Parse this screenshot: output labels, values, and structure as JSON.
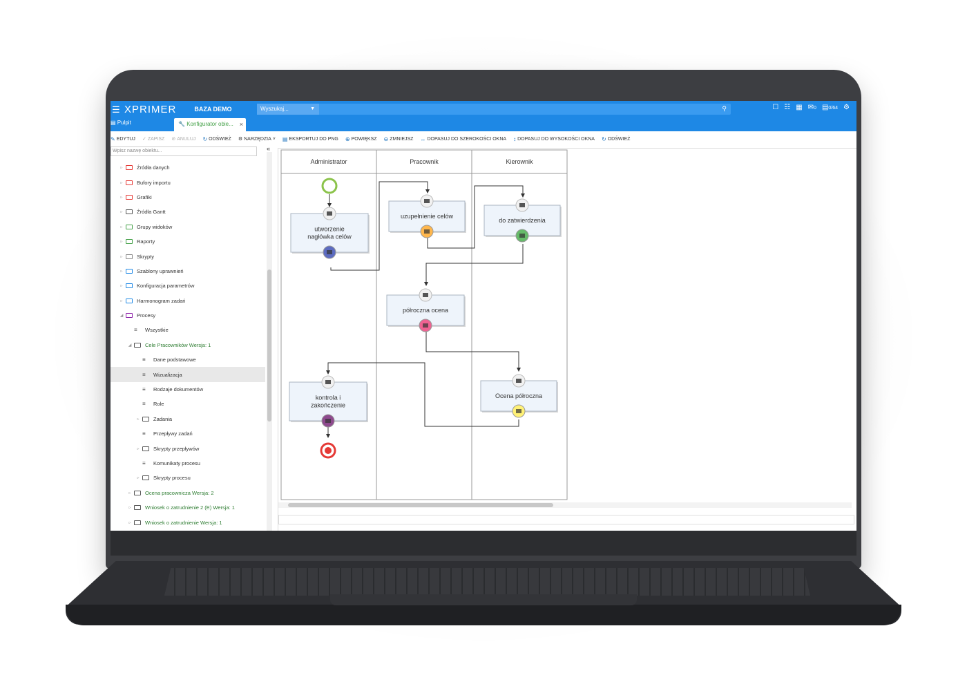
{
  "header": {
    "menu_icon": "hamburger-icon",
    "logo": "XPRIMER",
    "database": "BAZA DEMO",
    "search_select": "Wyszukaj...",
    "notifications_count": "0",
    "messages_count": "0/64"
  },
  "tabs": {
    "home": "Pulpit",
    "active": "Konfigurator obie...",
    "accent_color": "#43a047"
  },
  "toolbar": {
    "edit": "EDYTUJ",
    "save": "ZAPISZ",
    "cancel": "ANULUJ",
    "refresh": "ODŚWIEŻ",
    "tools": "NARZĘDZIA",
    "export_png": "EKSPORTUJ DO PNG",
    "zoom_in": "POWIĘKSZ",
    "zoom_out": "ZMNIEJSZ",
    "fit_width": "DOPASUJ DO SZEROKOŚCI OKNA",
    "fit_height": "DOPASUJ DO WYSOKOŚCI OKNA",
    "refresh2": "ODŚWIEŻ"
  },
  "sidebar": {
    "filter_placeholder": "Wpisz nazwę obiektu...",
    "items": [
      {
        "label": "Źródła danych",
        "level": 1,
        "icon": "folder-icon",
        "icon_color": "#e53935"
      },
      {
        "label": "Bufory importu",
        "level": 1,
        "icon": "folder-icon",
        "icon_color": "#e53935"
      },
      {
        "label": "Grafiki",
        "level": 1,
        "icon": "folder-icon",
        "icon_color": "#e53935"
      },
      {
        "label": "Źródła Gantt",
        "level": 1,
        "icon": "folder-icon",
        "icon_color": "#555555"
      },
      {
        "label": "Grupy widoków",
        "level": 1,
        "icon": "folder-icon",
        "icon_color": "#43a047"
      },
      {
        "label": "Raporty",
        "level": 1,
        "icon": "folder-icon",
        "icon_color": "#43a047"
      },
      {
        "label": "Skrypty",
        "level": 1,
        "icon": "folder-icon",
        "icon_color": "#888888"
      },
      {
        "label": "Szablony uprawnień",
        "level": 1,
        "icon": "folder-icon",
        "icon_color": "#1e88e5"
      },
      {
        "label": "Konfiguracja parametrów",
        "level": 1,
        "icon": "folder-icon",
        "icon_color": "#1e88e5"
      },
      {
        "label": "Harmonogram zadań",
        "level": 1,
        "icon": "folder-icon",
        "icon_color": "#1e88e5"
      },
      {
        "label": "Procesy",
        "level": 1,
        "icon": "folder-icon",
        "icon_color": "#8e24aa",
        "expanded": true
      },
      {
        "label": "Wszystkie",
        "level": 2,
        "icon": "list-icon"
      },
      {
        "label": "Cele Pracowników Wersja: 1",
        "level": 2,
        "icon": "folder-icon",
        "icon_color": "#555555",
        "expanded": true,
        "green": true
      },
      {
        "label": "Dane podstawowe",
        "level": 3,
        "icon": "list-icon"
      },
      {
        "label": "Wizualizacja",
        "level": 3,
        "icon": "list-icon",
        "selected": true
      },
      {
        "label": "Rodzaje dokumentów",
        "level": 3,
        "icon": "list-icon"
      },
      {
        "label": "Role",
        "level": 3,
        "icon": "list-icon"
      },
      {
        "label": "Zadania",
        "level": 3,
        "icon": "folder-icon",
        "icon_color": "#555555"
      },
      {
        "label": "Przepływy zadań",
        "level": 3,
        "icon": "list-icon"
      },
      {
        "label": "Skrypty przepływów",
        "level": 3,
        "icon": "folder-icon",
        "icon_color": "#555555"
      },
      {
        "label": "Komunikaty procesu",
        "level": 3,
        "icon": "list-icon"
      },
      {
        "label": "Skrypty procesu",
        "level": 3,
        "icon": "folder-icon",
        "icon_color": "#555555"
      },
      {
        "label": "Ocena pracownicza Wersja: 2",
        "level": 2,
        "icon": "folder-icon",
        "icon_color": "#555555",
        "green": true
      },
      {
        "label": "Wniosek o zatrudnienie 2 (E) Wersja: 1",
        "level": 2,
        "icon": "folder-icon",
        "icon_color": "#555555",
        "green": true
      },
      {
        "label": "Wniosek o zatrudnienie Wersja: 1",
        "level": 2,
        "icon": "folder-icon",
        "icon_color": "#555555",
        "green": true
      }
    ]
  },
  "diagram": {
    "lanes": [
      "Administrator",
      "Pracownik",
      "Kierownik"
    ],
    "tasks": [
      {
        "id": "t1",
        "lines": [
          "utworzenie",
          "nagłówka celów"
        ],
        "badge_color": "#5c6bc0"
      },
      {
        "id": "t2",
        "lines": [
          "uzupełnienie celów"
        ],
        "badge_color": "#ffb74d"
      },
      {
        "id": "t3",
        "lines": [
          "do zatwierdzenia"
        ],
        "badge_color": "#66bb6a"
      },
      {
        "id": "t4",
        "lines": [
          "półroczna ocena"
        ],
        "badge_color": "#f06292"
      },
      {
        "id": "t5",
        "lines": [
          "kontrola i",
          "zakończenie"
        ],
        "badge_color": "#8e4a8e"
      },
      {
        "id": "t6",
        "lines": [
          "Ocena półroczna"
        ],
        "badge_color": "#fff176"
      }
    ],
    "start_color": "#8bc34a",
    "end_color": "#e53935"
  }
}
